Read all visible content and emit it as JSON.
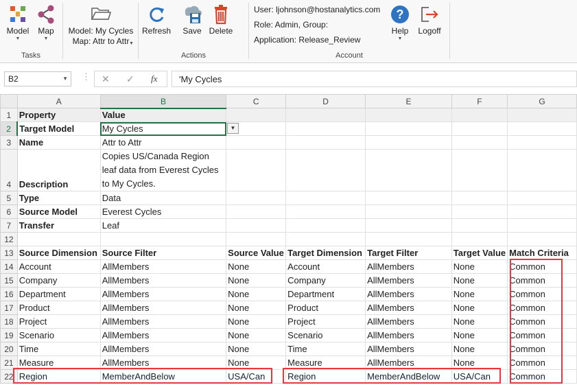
{
  "ribbon": {
    "tasks": {
      "group_label": "Tasks",
      "model_label": "Model",
      "map_label": "Map"
    },
    "selectors": {
      "model_line": "Model: My Cycles",
      "map_line": "Map: Attr to Attr"
    },
    "actions": {
      "group_label": "Actions",
      "refresh_label": "Refresh",
      "save_label": "Save",
      "delete_label": "Delete"
    },
    "account": {
      "group_label": "Account",
      "user": "User: ljohnson@hostanalytics.com",
      "role": "Role: Admin, Group:",
      "application": "Application: Release_Review",
      "help_label": "Help",
      "logoff_label": "Logoff"
    },
    "icon_names": [
      "model-icon",
      "map-icon",
      "folder-icon",
      "refresh-icon",
      "save-icon",
      "delete-icon",
      "help-icon",
      "logoff-icon"
    ],
    "colors": {
      "accent_green": "#217346",
      "delete_red": "#d9452b",
      "help_blue": "#2e74c0",
      "highlight_red": "#e8383d"
    }
  },
  "formula_bar": {
    "name_box": "B2",
    "formula": "'My Cycles"
  },
  "columns": [
    "A",
    "B",
    "C",
    "D",
    "E",
    "F",
    "G"
  ],
  "rows": [
    {
      "n": "1",
      "bold": true,
      "cells": [
        "Property",
        "Value",
        "",
        "",
        "",
        "",
        ""
      ]
    },
    {
      "n": "2",
      "cells": [
        "Target Model",
        "My Cycles",
        "",
        "",
        "",
        "",
        ""
      ]
    },
    {
      "n": "3",
      "cells": [
        "Name",
        "Attr to Attr",
        "",
        "",
        "",
        "",
        ""
      ]
    },
    {
      "n": "4",
      "cells": [
        "Description",
        "Copies US/Canada Region leaf data from Everest Cycles to My Cycles.",
        "",
        "",
        "",
        "",
        ""
      ]
    },
    {
      "n": "5",
      "cells": [
        "Type",
        "Data",
        "",
        "",
        "",
        "",
        ""
      ]
    },
    {
      "n": "6",
      "cells": [
        "Source Model",
        "Everest Cycles",
        "",
        "",
        "",
        "",
        ""
      ]
    },
    {
      "n": "7",
      "cells": [
        "Transfer",
        "Leaf",
        "",
        "",
        "",
        "",
        ""
      ]
    },
    {
      "n": "12",
      "cells": [
        "",
        "",
        "",
        "",
        "",
        "",
        ""
      ]
    },
    {
      "n": "13",
      "bold": true,
      "cells": [
        "Source Dimension",
        "Source Filter",
        "Source Value",
        "Target Dimension",
        "Target Filter",
        "Target Value",
        "Match Criteria"
      ]
    },
    {
      "n": "14",
      "cells": [
        "Account",
        "AllMembers",
        "None",
        "Account",
        "AllMembers",
        "None",
        "Common"
      ]
    },
    {
      "n": "15",
      "cells": [
        "Company",
        "AllMembers",
        "None",
        "Company",
        "AllMembers",
        "None",
        "Common"
      ]
    },
    {
      "n": "16",
      "cells": [
        "Department",
        "AllMembers",
        "None",
        "Department",
        "AllMembers",
        "None",
        "Common"
      ]
    },
    {
      "n": "17",
      "cells": [
        "Product",
        "AllMembers",
        "None",
        "Product",
        "AllMembers",
        "None",
        "Common"
      ]
    },
    {
      "n": "18",
      "cells": [
        "Project",
        "AllMembers",
        "None",
        "Project",
        "AllMembers",
        "None",
        "Common"
      ]
    },
    {
      "n": "19",
      "cells": [
        "Scenario",
        "AllMembers",
        "None",
        "Scenario",
        "AllMembers",
        "None",
        "Common"
      ]
    },
    {
      "n": "20",
      "cells": [
        "Time",
        "AllMembers",
        "None",
        "Time",
        "AllMembers",
        "None",
        "Common"
      ]
    },
    {
      "n": "21",
      "cells": [
        "Measure",
        "AllMembers",
        "None",
        "Measure",
        "AllMembers",
        "None",
        "Common"
      ]
    },
    {
      "n": "22",
      "cells": [
        "Region",
        "MemberAndBelow",
        "USA/Can",
        "Region",
        "MemberAndBelow",
        "USA/Can",
        "Common"
      ]
    }
  ]
}
